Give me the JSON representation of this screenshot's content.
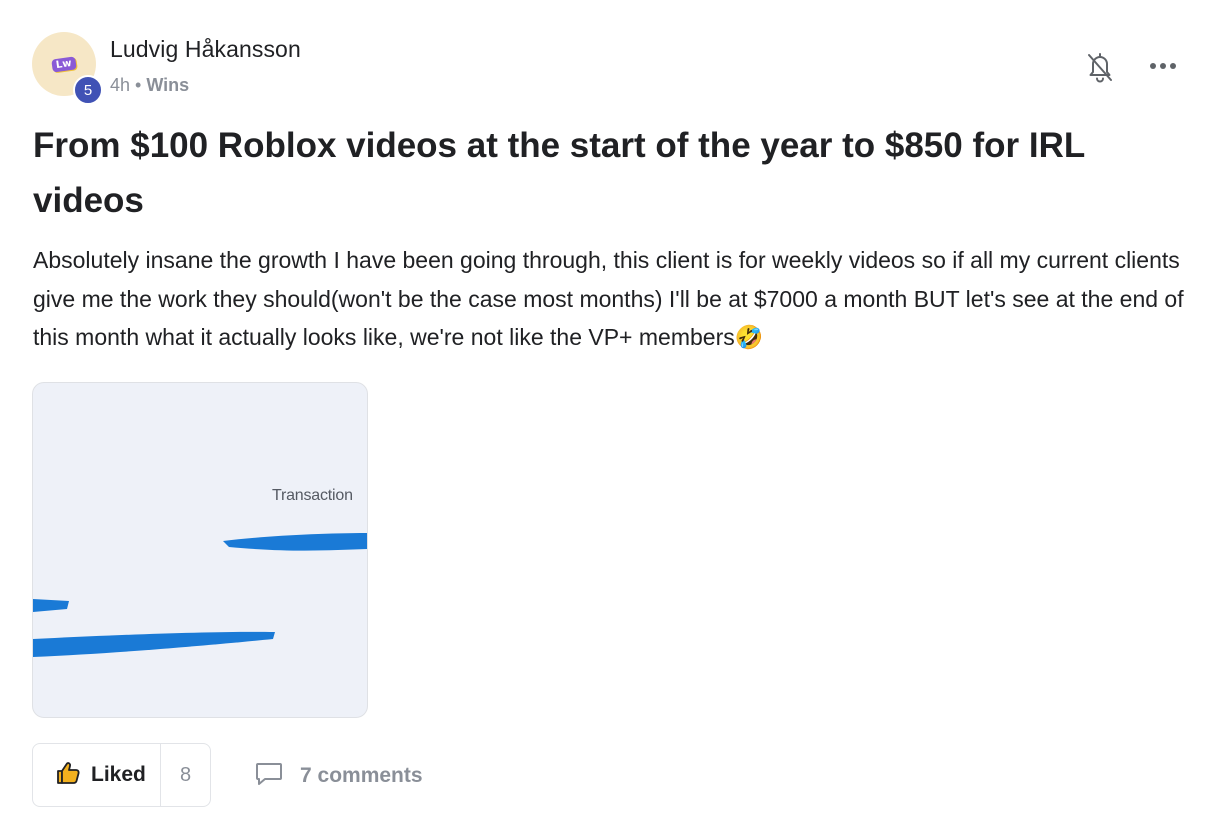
{
  "author": {
    "name": "Ludvig Håkansson",
    "level": "5",
    "avatar_logo_text": "Lw"
  },
  "meta": {
    "time": "4h",
    "separator": " • ",
    "category": "Wins"
  },
  "post": {
    "title": "From $100 Roblox videos at the start of the year to $850 for IRL videos",
    "body": "Absolutely insane the growth I have been going through, this client is for weekly videos so if all my current clients give me the work they should(won't be the case most months) I'll be at $7000 a month BUT let's see at the end of this month what it actually looks like, we're not like the VP+ members🤣"
  },
  "attachment": {
    "caption": "Transaction",
    "redaction_color": "#1a7ad6",
    "background_color": "#eef1f8"
  },
  "actions": {
    "like_label": "Liked",
    "like_count": "8",
    "comments_label": "7 comments"
  },
  "icons": {
    "like": "thumbs-up-icon",
    "bell": "bell-off-icon",
    "more": "more-horizontal-icon",
    "comment": "comment-bubble-icon"
  },
  "colors": {
    "badge": "#4052b5",
    "muted": "#8a8f98",
    "thumb": "#f2b01e"
  }
}
